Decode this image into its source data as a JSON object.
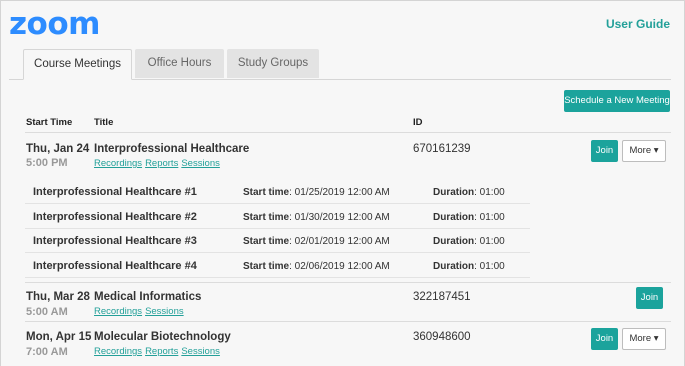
{
  "header": {
    "logo": "zoom",
    "user_guide": "User Guide"
  },
  "tabs": [
    {
      "label": "Course Meetings",
      "active": true
    },
    {
      "label": "Office Hours",
      "active": false
    },
    {
      "label": "Study Groups",
      "active": false
    }
  ],
  "actions": {
    "schedule_label": "Schedule a New Meeting"
  },
  "columns": {
    "start_time": "Start Time",
    "title": "Title",
    "id": "ID"
  },
  "meetings": [
    {
      "date": "Thu, Jan 24",
      "time": "5:00 PM",
      "title": "Interprofessional Healthcare",
      "links": [
        "Recordings",
        "Reports",
        "Sessions"
      ],
      "id": "670161239",
      "join_label": "Join",
      "more_label": "More ▾"
    },
    {
      "date": "Thu, Mar 28",
      "time": "5:00 AM",
      "title": "Medical Informatics",
      "links": [
        "Recordings",
        "Sessions"
      ],
      "id": "322187451",
      "join_label": "Join"
    },
    {
      "date": "Mon, Apr 15",
      "time": "7:00 AM",
      "title": "Molecular Biotechnology",
      "links": [
        "Recordings",
        "Reports",
        "Sessions"
      ],
      "id": "360948600",
      "join_label": "Join",
      "more_label": "More ▾"
    }
  ],
  "occurrence_labels": {
    "start": "Start time",
    "duration": "Duration"
  },
  "occurrences": [
    {
      "name": "Interprofessional Healthcare #1",
      "start": ": 01/25/2019 12:00 AM",
      "duration": ": 01:00"
    },
    {
      "name": "Interprofessional Healthcare #2",
      "start": ": 01/30/2019 12:00 AM",
      "duration": ": 01:00"
    },
    {
      "name": "Interprofessional Healthcare #3",
      "start": ": 02/01/2019 12:00 AM",
      "duration": ": 01:00"
    },
    {
      "name": "Interprofessional Healthcare #4",
      "start": ": 02/06/2019 12:00 AM",
      "duration": ": 01:00"
    }
  ],
  "colors": {
    "brand": "#2d8cff",
    "accent": "#1ba39c"
  }
}
